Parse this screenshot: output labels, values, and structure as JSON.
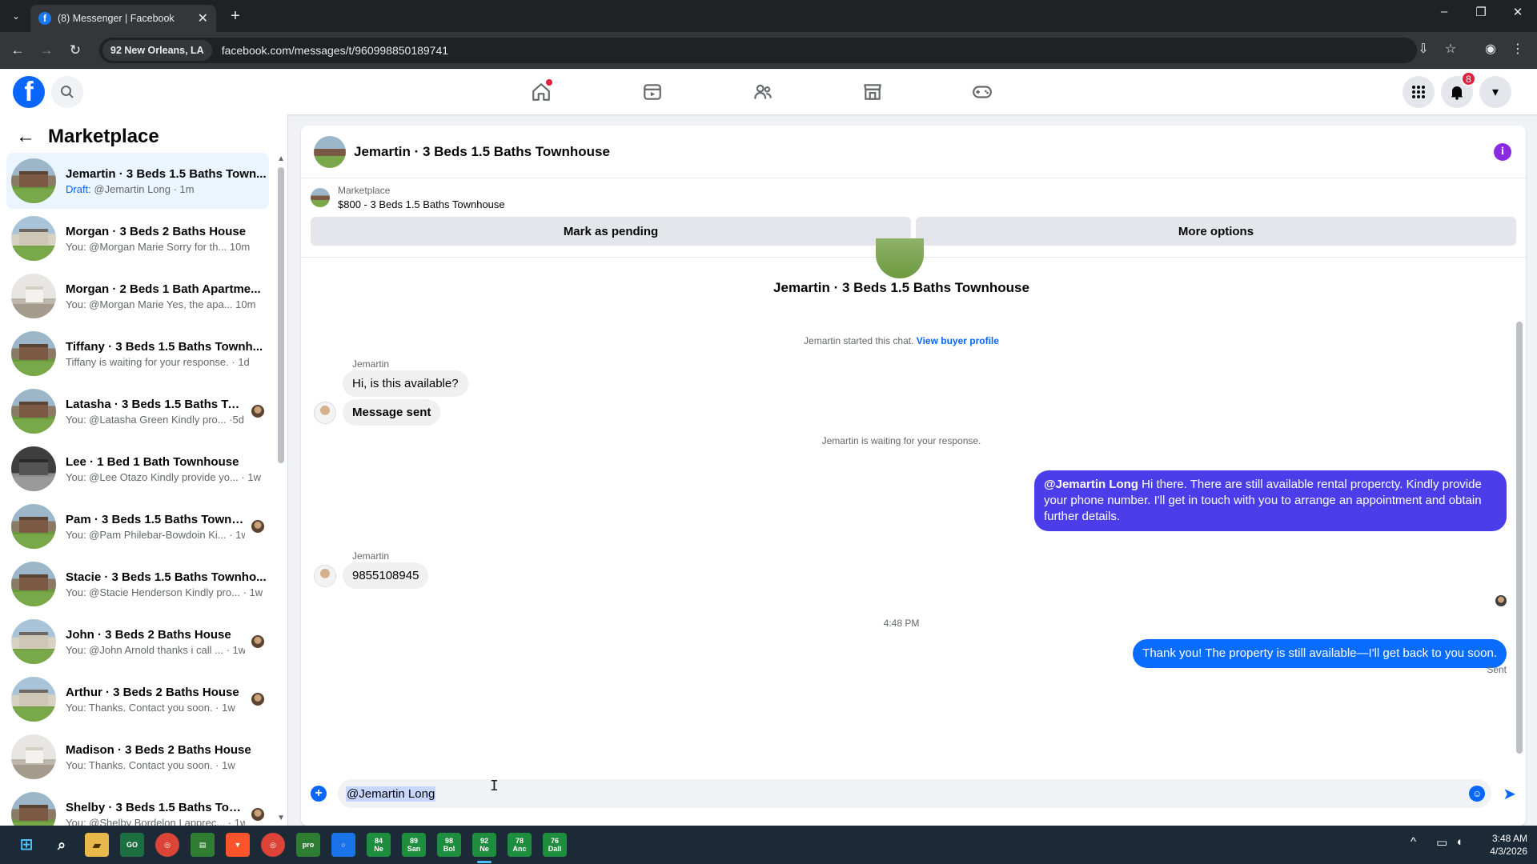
{
  "browser": {
    "tab_title": "(8) Messenger | Facebook",
    "location_chip": "92 New Orleans, LA",
    "url": "facebook.com/messages/t/960998850189741"
  },
  "header": {
    "notifications_count": "8"
  },
  "sidebar": {
    "title": "Marketplace",
    "conversations": [
      {
        "name": "Jemartin · 3 Beds 1.5 Baths Town...",
        "draft_label": "Draft:",
        "preview": " @Jemartin Long · 1m",
        "active": true
      },
      {
        "name": "Morgan · 3 Beds 2 Baths House",
        "preview": "You: @Morgan Marie Sorry for th...  10m"
      },
      {
        "name": "Morgan · 2 Beds 1 Bath Apartme...",
        "preview": "You: @Morgan Marie Yes, the apa...  10m"
      },
      {
        "name": "Tiffany · 3 Beds 1.5 Baths Townh...",
        "preview": "Tiffany is waiting for your response. · 1d"
      },
      {
        "name": "Latasha · 3 Beds 1.5 Baths Tow...",
        "preview": "You: @Latasha Green Kindly pro...  ·5d"
      },
      {
        "name": "Lee · 1 Bed 1 Bath Townhouse",
        "preview": "You: @Lee Otazo Kindly provide yo... · 1w"
      },
      {
        "name": "Pam · 3 Beds 1.5 Baths Townh...",
        "preview": "You: @Pam Philebar-Bowdoin Ki... · 1w"
      },
      {
        "name": "Stacie · 3 Beds 1.5 Baths Townho...",
        "preview": "You: @Stacie Henderson Kindly pro... · 1w"
      },
      {
        "name": "John · 3 Beds 2 Baths House",
        "preview": "You: @John Arnold thanks i call ... · 1w"
      },
      {
        "name": "Arthur · 3 Beds 2 Baths House",
        "preview": "You: Thanks. Contact you soon. · 1w"
      },
      {
        "name": "Madison · 3 Beds 2 Baths House",
        "preview": "You: Thanks. Contact you soon. · 1w"
      },
      {
        "name": "Shelby · 3 Beds 1.5 Baths Tow...",
        "preview": "You: @Shelby Bordelon I apprec... · 1w"
      }
    ]
  },
  "chat": {
    "title": "Jemartin · 3 Beds 1.5 Baths Townhouse",
    "marketplace_label": "Marketplace",
    "listing": "$800 - 3 Beds 1.5 Baths Townhouse",
    "mark_pending": "Mark as pending",
    "more_options": "More options",
    "center_title": "Jemartin · 3 Beds 1.5 Baths Townhouse",
    "started_text": "Jemartin started this chat.",
    "view_profile": "View buyer profile",
    "sender_name": "Jemartin",
    "msg1": "Hi, is this available?",
    "msg2": "Message sent",
    "waiting": "Jemartin is waiting for your response.",
    "out1_mention": "@Jemartin Long",
    "out1_text": " Hi there. There are still available rental propercty. Kindly provide your phone number. I'll get in touch with you to arrange an appointment and obtain further details.",
    "sender_name2": "Jemartin",
    "msg3": "9855108945",
    "time": "4:48 PM",
    "out2": "Thank you! The property is still available—I'll get back to you soon.",
    "sent_label": "Sent",
    "composer_value": "@Jemartin Long"
  },
  "taskbar": {
    "apps": [
      "84\nNe",
      "89\nSan",
      "98\nBol",
      "92\nNe",
      "78\nAnc",
      "76\nDall"
    ],
    "time": "3:48 AM",
    "date": "4/3/2026"
  }
}
